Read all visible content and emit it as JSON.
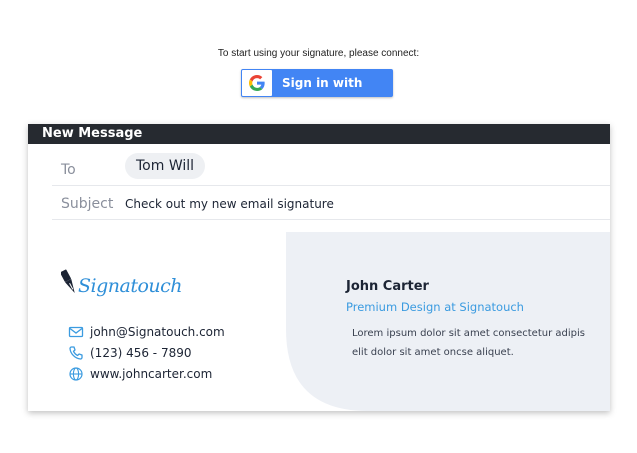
{
  "connect_prompt": "To start using your signature, please connect:",
  "google_button": {
    "label": "Sign in with Google",
    "icon": "google-g-icon"
  },
  "compose": {
    "title": "New Message",
    "to_label": "To",
    "to_recipient": "Tom Will",
    "subject_label": "Subject",
    "subject_value": "Check out my new email signature"
  },
  "signature": {
    "logo_text": "Signatouch",
    "email": "john@Signatouch.com",
    "phone": "(123) 456 - 7890",
    "website": "www.johncarter.com",
    "name": "John Carter",
    "role": "Premium Design at Signatouch",
    "bio": "Lorem ipsum dolor sit amet consectetur adipis elit dolor sit amet oncse aliquet."
  },
  "colors": {
    "google_blue": "#4285f4",
    "titlebar": "#262a30",
    "accent_blue": "#3b9be0",
    "signature_panel": "#edf0f5"
  }
}
